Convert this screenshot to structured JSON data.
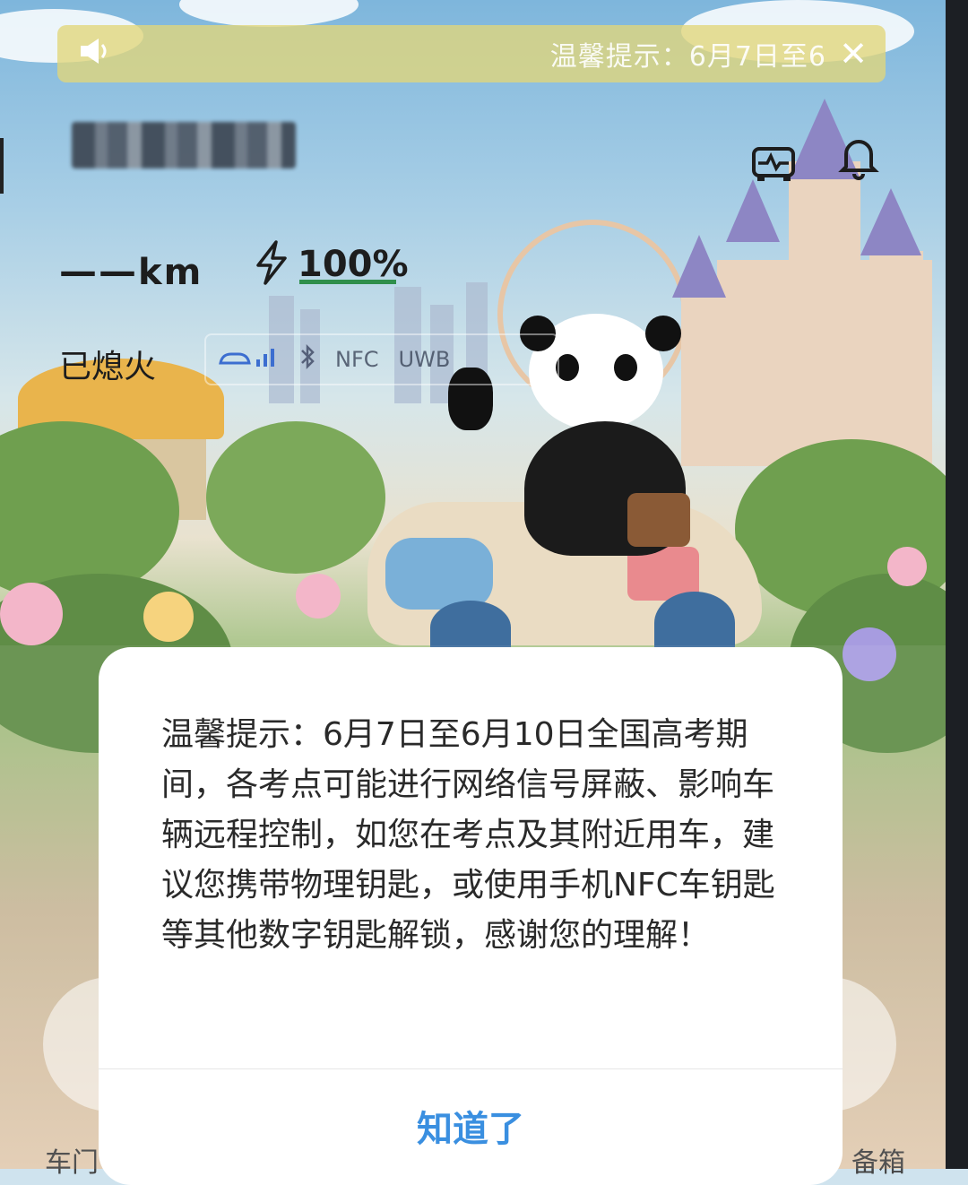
{
  "notice_bar": {
    "icon": "speaker-icon",
    "text": "温馨提示：6月7日至6",
    "close_icon": "close-icon"
  },
  "header": {
    "icons": [
      "vehicle-health-icon",
      "bell-icon"
    ]
  },
  "status": {
    "range_value": "——",
    "range_unit": "km",
    "battery_icon": "lightning-icon",
    "battery_percent": "100%",
    "battery_level": 1.0,
    "engine_state": "已熄火",
    "connectivity": {
      "car_signal_icon": "car-signal-icon",
      "bluetooth_icon": "bluetooth-icon",
      "nfc": "NFC",
      "uwb": "UWB"
    }
  },
  "bottom": {
    "left_label": "车门",
    "right_label": "备箱"
  },
  "dialog": {
    "message": "温馨提示：6月7日至6月10日全国高考期间，各考点可能进行网络信号屏蔽、影响车辆远程控制，如您在考点及其附近用车，建议您携带物理钥匙，或使用手机NFC车钥匙等其他数字钥匙解锁，感谢您的理解！",
    "ok_label": "知道了"
  },
  "colors": {
    "notice_bg": "#e2d67a",
    "battery_fill": "#2f8f4c",
    "ok_text": "#3a8fe0"
  }
}
